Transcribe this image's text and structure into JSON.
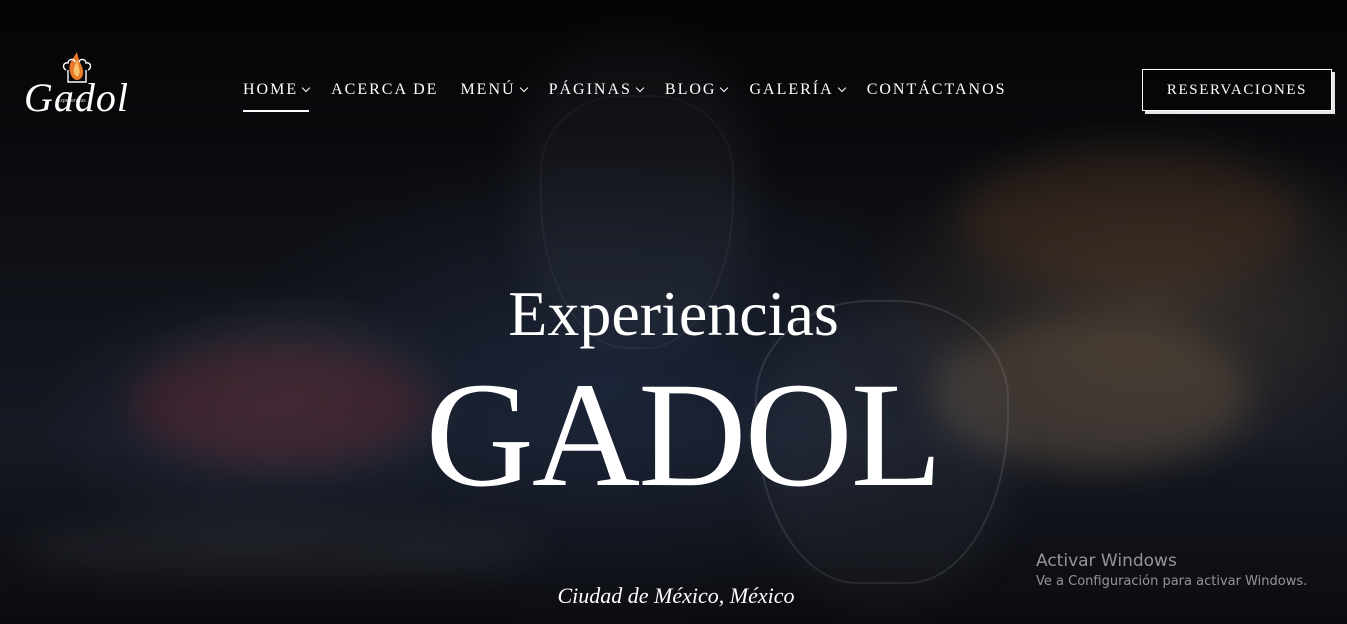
{
  "brand": {
    "logo_text": "Gadol",
    "logo_small": "Experiencias"
  },
  "nav": {
    "items": [
      {
        "label": "HOME",
        "has_dropdown": true,
        "active": true
      },
      {
        "label": "ACERCA DE",
        "has_dropdown": false,
        "active": false
      },
      {
        "label": "MENÚ",
        "has_dropdown": true,
        "active": false
      },
      {
        "label": "PÁGINAS",
        "has_dropdown": true,
        "active": false
      },
      {
        "label": "BLOG",
        "has_dropdown": true,
        "active": false
      },
      {
        "label": "GALERÍA",
        "has_dropdown": true,
        "active": false
      },
      {
        "label": "CONTÁCTANOS",
        "has_dropdown": false,
        "active": false
      }
    ],
    "cta_label": "RESERVACIONES"
  },
  "hero": {
    "subtitle": "Experiencias",
    "title": "GADOL",
    "location": "Ciudad de México, México"
  },
  "watermark": {
    "title": "Activar Windows",
    "subtitle": "Ve a Configuración para activar Windows."
  },
  "colors": {
    "text": "#ffffff",
    "flame": "#e8782a",
    "background": "#0c0d12"
  }
}
